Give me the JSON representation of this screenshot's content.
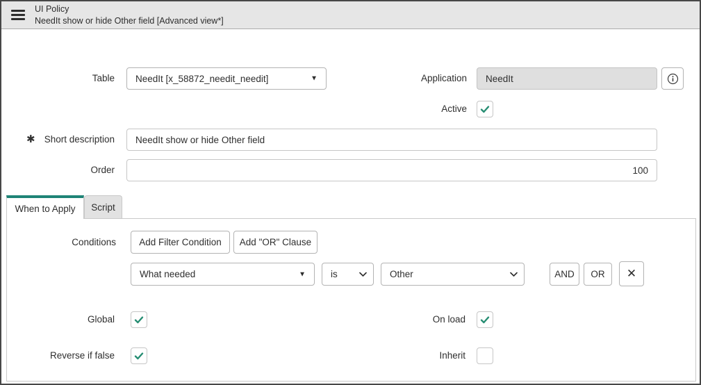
{
  "header": {
    "title": "UI Policy",
    "subtitle": "NeedIt show or hide Other field [Advanced view*]"
  },
  "form": {
    "table": {
      "label": "Table",
      "value": "NeedIt [x_58872_needit_needit]"
    },
    "application": {
      "label": "Application",
      "value": "NeedIt"
    },
    "active": {
      "label": "Active",
      "checked": true
    },
    "short_description": {
      "label": "Short description",
      "value": "NeedIt show or hide Other field"
    },
    "order": {
      "label": "Order",
      "value": "100"
    }
  },
  "tabs": [
    {
      "label": "When to Apply",
      "active": true
    },
    {
      "label": "Script",
      "active": false
    }
  ],
  "when_to_apply": {
    "conditions": {
      "label": "Conditions",
      "add_filter_button": "Add Filter Condition",
      "add_or_button": "Add \"OR\" Clause",
      "row": {
        "field": "What needed",
        "operator": "is",
        "value": "Other",
        "and_button": "AND",
        "or_button": "OR"
      }
    },
    "global": {
      "label": "Global",
      "checked": true
    },
    "on_load": {
      "label": "On load",
      "checked": true
    },
    "reverse_if_false": {
      "label": "Reverse if false",
      "checked": true
    },
    "inherit": {
      "label": "Inherit",
      "checked": false
    }
  },
  "icons": {
    "dropdown_arrow": "▼",
    "delete": "✕",
    "mandatory": "✱"
  },
  "colors": {
    "accent_teal": "#1f8476",
    "checkmark_teal": "#278e73",
    "header_bg": "#e6e6e6",
    "readonly_bg": "#dfdfdf"
  }
}
